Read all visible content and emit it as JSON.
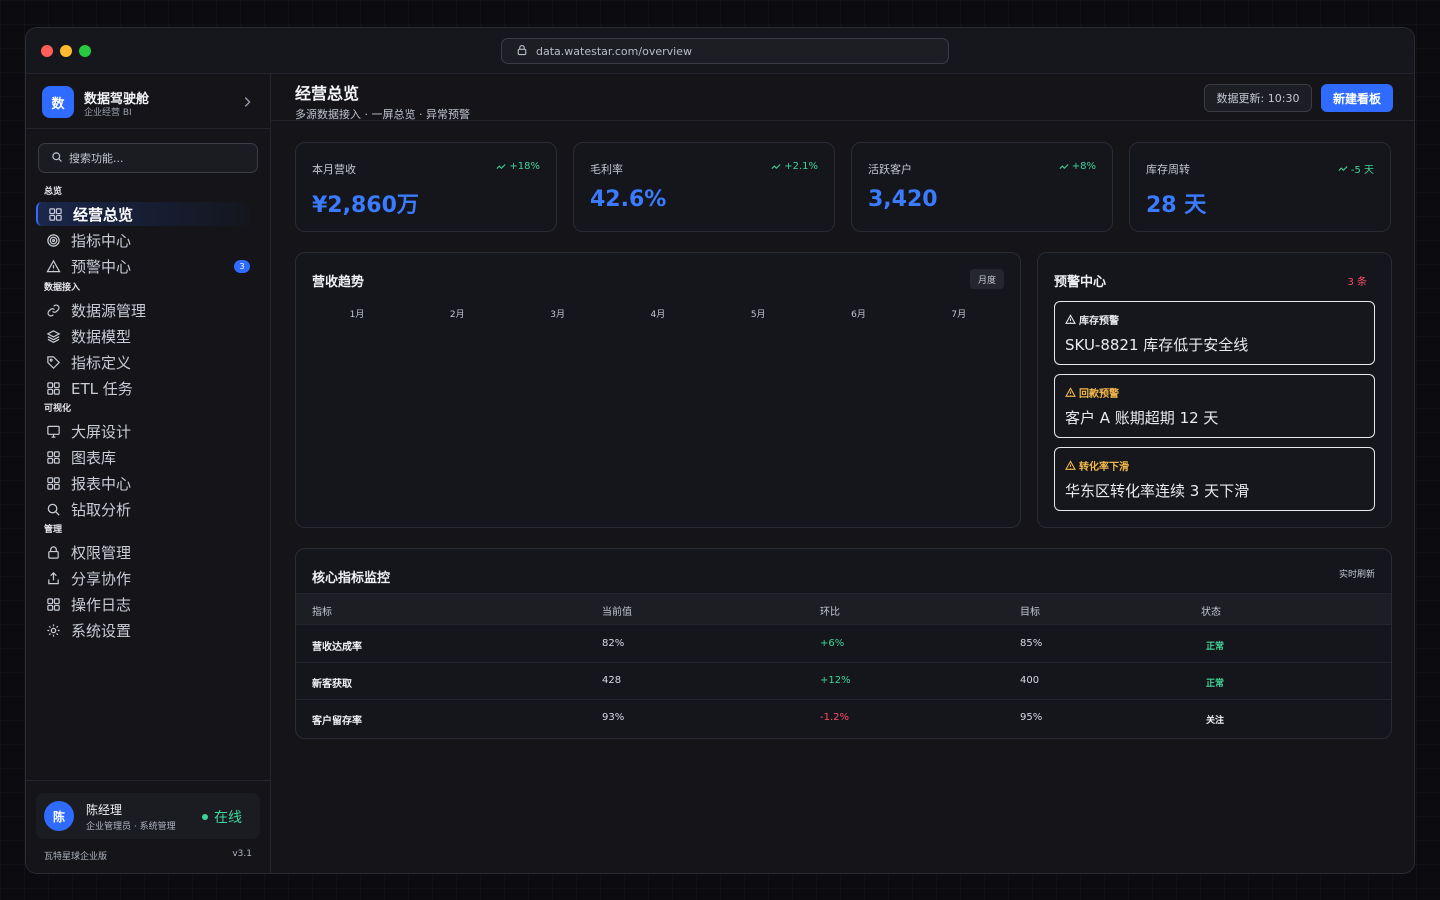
{
  "browser": {
    "url": "data.watestar.com/overview"
  },
  "sidebar": {
    "brand": {
      "logo": "数",
      "name": "数据驾驶舱",
      "sub": "企业经营 BI"
    },
    "search_placeholder": "搜索功能...",
    "groups": [
      {
        "title": "总览",
        "items": [
          {
            "label": "经营总览",
            "icon": "grid-icon",
            "active": true
          },
          {
            "label": "指标中心",
            "icon": "target-icon"
          },
          {
            "label": "预警中心",
            "icon": "warning-icon",
            "badge": "3"
          }
        ]
      },
      {
        "title": "数据接入",
        "items": [
          {
            "label": "数据源管理",
            "icon": "link-icon"
          },
          {
            "label": "数据模型",
            "icon": "layers-icon"
          },
          {
            "label": "指标定义",
            "icon": "tag-icon"
          },
          {
            "label": "ETL 任务",
            "icon": "grid-icon"
          }
        ]
      },
      {
        "title": "可视化",
        "items": [
          {
            "label": "大屏设计",
            "icon": "monitor-icon"
          },
          {
            "label": "图表库",
            "icon": "grid-icon"
          },
          {
            "label": "报表中心",
            "icon": "grid-icon"
          },
          {
            "label": "钻取分析",
            "icon": "search-icon"
          }
        ]
      },
      {
        "title": "管理",
        "items": [
          {
            "label": "权限管理",
            "icon": "lock-icon"
          },
          {
            "label": "分享协作",
            "icon": "share-icon"
          },
          {
            "label": "操作日志",
            "icon": "grid-icon"
          },
          {
            "label": "系统设置",
            "icon": "gear-icon"
          }
        ]
      }
    ],
    "user": {
      "avatar": "陈",
      "name": "陈经理",
      "role": "企业管理员 · 系统管理",
      "status": "在线"
    },
    "edition": "瓦特星球企业版",
    "version": "v3.1"
  },
  "header": {
    "title": "经营总览",
    "subtitle": "多源数据接入 · 一屏总览 · 异常预警",
    "update_label": "数据更新: 10:30",
    "new_button": "新建看板"
  },
  "kpis": [
    {
      "label": "本月营收",
      "delta": "+18%",
      "value": "¥2,860万"
    },
    {
      "label": "毛利率",
      "delta": "+2.1%",
      "value": "42.6%"
    },
    {
      "label": "活跃客户",
      "delta": "+8%",
      "value": "3,420"
    },
    {
      "label": "库存周转",
      "delta": "-5 天",
      "value": "28 天"
    }
  ],
  "trend": {
    "title": "营收趋势",
    "period": "月度",
    "months": [
      "1月",
      "2月",
      "3月",
      "4月",
      "5月",
      "6月",
      "7月"
    ]
  },
  "alerts": {
    "title": "预警中心",
    "count": "3 条",
    "items": [
      {
        "type": "库存预警",
        "text": "SKU-8821 库存低于安全线",
        "color": "#e9ebf0"
      },
      {
        "type": "回款预警",
        "text": "客户 A 账期超期 12 天",
        "color": "#f2b84b"
      },
      {
        "type": "转化率下滑",
        "text": "华东区转化率连续 3 天下滑",
        "color": "#f2b84b"
      }
    ]
  },
  "monitor": {
    "title": "核心指标监控",
    "live": "实时刷新",
    "columns": [
      "指标",
      "当前值",
      "环比",
      "目标",
      "状态"
    ],
    "rows": [
      {
        "name": "营收达成率",
        "current": "82%",
        "mom": "+6%",
        "target": "85%",
        "status": "正常"
      },
      {
        "name": "新客获取",
        "current": "428",
        "mom": "+12%",
        "target": "400",
        "status": "正常"
      },
      {
        "name": "客户留存率",
        "current": "93%",
        "mom": "-1.2%",
        "target": "95%",
        "status": "关注"
      }
    ]
  },
  "colors": {
    "accent": "#2f6bff",
    "positive": "#3ed598",
    "negative": "#ff4d67",
    "warning": "#f2b84b"
  }
}
